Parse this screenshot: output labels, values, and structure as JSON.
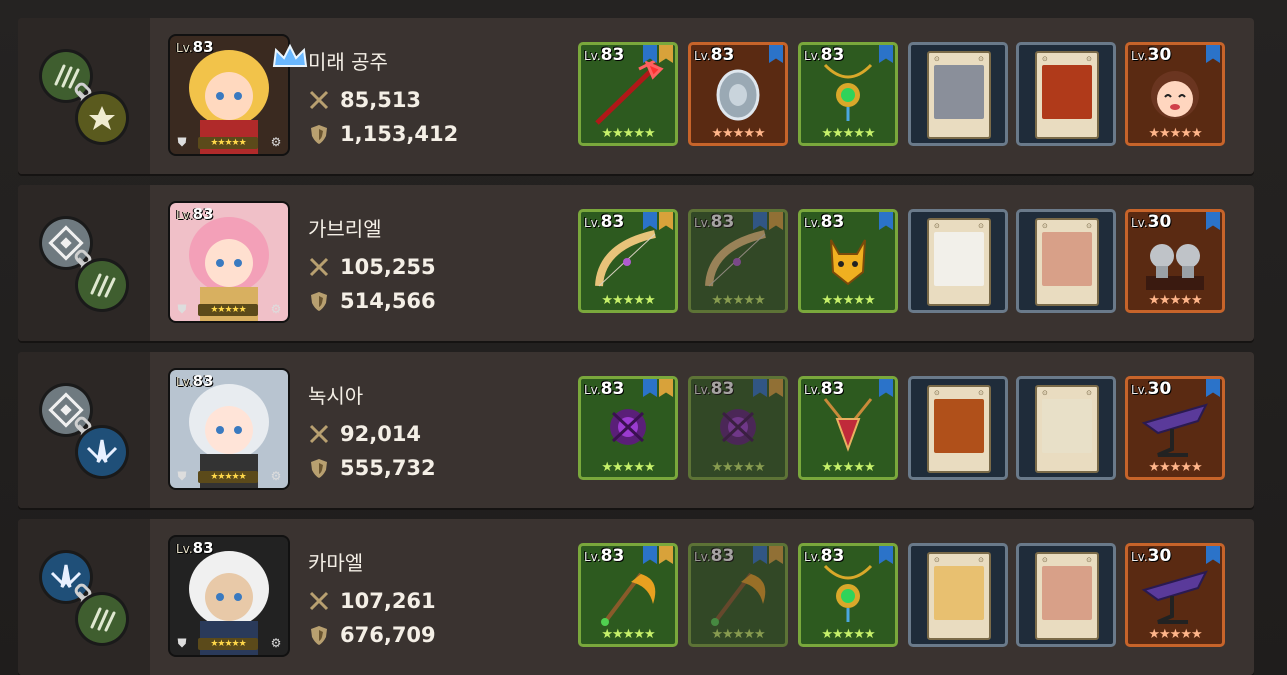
{
  "accent_colors": {
    "green_frame": "#7aa83c",
    "orange_frame": "#c7642a",
    "card_frame": "#6a7a8a",
    "star_gold": "#ffd84a"
  },
  "rows": [
    {
      "name": "미래 공주",
      "level": "83",
      "lv_prefix": "Lv.",
      "power": "85,513",
      "defense": "1,153,412",
      "has_crown": true,
      "stars": "★★★★★",
      "chain_top": "claw",
      "chain_bottom": "star",
      "slots": [
        {
          "type": "weapon",
          "level": "83",
          "frame": "green",
          "art": "red-trident-icon",
          "stars": "★★★★★",
          "dim": false
        },
        {
          "type": "shield",
          "level": "83",
          "frame": "orange",
          "art": "silver-shield-icon",
          "stars": "★★★★★",
          "dim": false
        },
        {
          "type": "accessory",
          "level": "83",
          "frame": "green",
          "art": "emerald-amulet-icon",
          "stars": "★★★★★",
          "dim": false
        },
        {
          "type": "card",
          "art": "old-man-card-icon"
        },
        {
          "type": "card",
          "art": "fire-warrior-card-icon"
        },
        {
          "type": "costume",
          "level": "30",
          "frame": "orange",
          "art": "girl-face-icon",
          "stars": "★★★★★",
          "dim": false
        }
      ]
    },
    {
      "name": "가브리엘",
      "level": "83",
      "lv_prefix": "Lv.",
      "power": "105,255",
      "defense": "514,566",
      "has_crown": false,
      "stars": "★★★★★",
      "chain_top": "rune",
      "chain_bottom": "claw",
      "slots": [
        {
          "type": "weapon",
          "level": "83",
          "frame": "green",
          "art": "golden-bow-icon",
          "stars": "★★★★★",
          "dim": false
        },
        {
          "type": "weapon",
          "level": "83",
          "frame": "green",
          "art": "golden-bow-icon",
          "stars": "★★★★★",
          "dim": true
        },
        {
          "type": "accessory",
          "level": "83",
          "frame": "green",
          "art": "fox-mask-icon",
          "stars": "★★★★★",
          "dim": false
        },
        {
          "type": "card",
          "art": "dish-card-icon"
        },
        {
          "type": "card",
          "art": "fox-girl-card-icon"
        },
        {
          "type": "costume",
          "level": "30",
          "frame": "orange",
          "art": "statue-duo-icon",
          "stars": "★★★★★",
          "dim": false
        }
      ]
    },
    {
      "name": "녹시아",
      "level": "83",
      "lv_prefix": "Lv.",
      "power": "92,014",
      "defense": "555,732",
      "has_crown": false,
      "stars": "★★★★★",
      "chain_top": "rune",
      "chain_bottom": "wing",
      "slots": [
        {
          "type": "weapon",
          "level": "83",
          "frame": "green",
          "art": "purple-orb-icon",
          "stars": "★★★★★",
          "dim": false
        },
        {
          "type": "weapon",
          "level": "83",
          "frame": "green",
          "art": "purple-orb-icon",
          "stars": "★★★★★",
          "dim": true
        },
        {
          "type": "accessory",
          "level": "83",
          "frame": "green",
          "art": "ruby-amulet-icon",
          "stars": "★★★★★",
          "dim": false
        },
        {
          "type": "card",
          "art": "potion-jar-card-icon"
        },
        {
          "type": "card",
          "art": "green-sword-card-icon"
        },
        {
          "type": "costume",
          "level": "30",
          "frame": "orange",
          "art": "purple-dragon-stand-icon",
          "stars": "★★★★★",
          "dim": false
        }
      ]
    },
    {
      "name": "카마엘",
      "level": "83",
      "lv_prefix": "Lv.",
      "power": "107,261",
      "defense": "676,709",
      "has_crown": false,
      "stars": "★★★★★",
      "chain_top": "wing",
      "chain_bottom": "claw",
      "slots": [
        {
          "type": "weapon",
          "level": "83",
          "frame": "green",
          "art": "golden-scythe-icon",
          "stars": "★★★★★",
          "dim": false
        },
        {
          "type": "weapon",
          "level": "83",
          "frame": "green",
          "art": "golden-scythe-icon",
          "stars": "★★★★★",
          "dim": true
        },
        {
          "type": "accessory",
          "level": "83",
          "frame": "green",
          "art": "emerald-amulet-icon",
          "stars": "★★★★★",
          "dim": false
        },
        {
          "type": "card",
          "art": "blonde-girl-card-icon"
        },
        {
          "type": "card",
          "art": "fox-girl-card-icon"
        },
        {
          "type": "costume",
          "level": "30",
          "frame": "orange",
          "art": "purple-dragon-stand-icon",
          "stars": "★★★★★",
          "dim": false
        }
      ]
    }
  ]
}
